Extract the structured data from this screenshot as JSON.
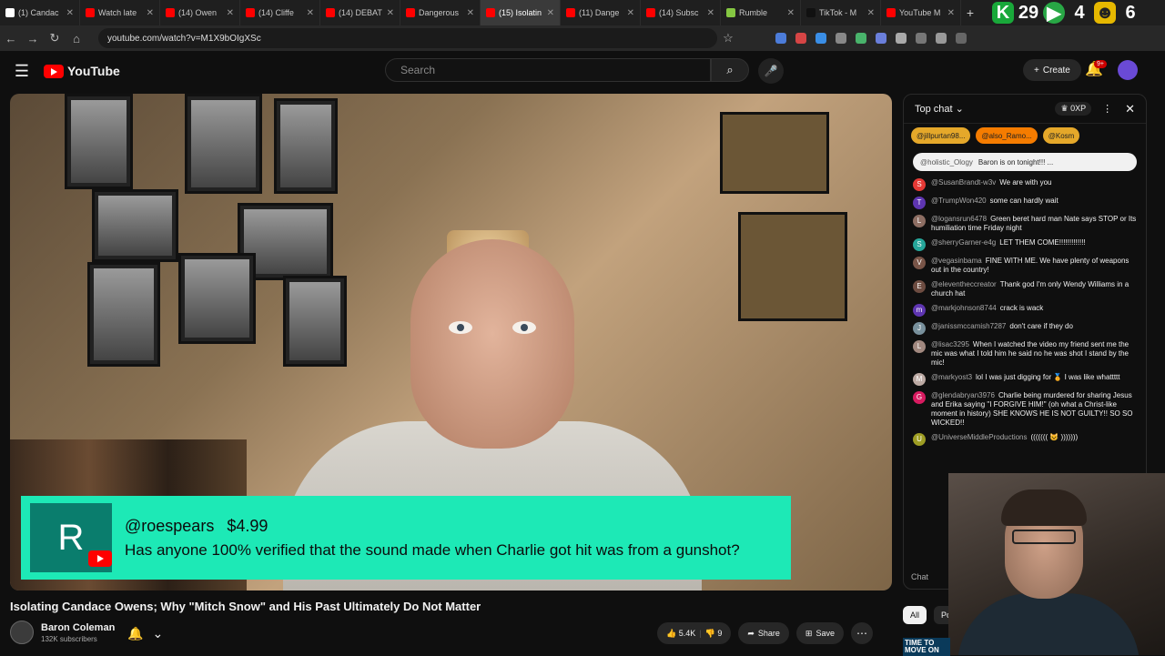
{
  "browser": {
    "tabs": [
      {
        "label": "(1) Candac",
        "color": "#ffffff",
        "active": false
      },
      {
        "label": "Watch late",
        "color": "#ff0000",
        "active": false
      },
      {
        "label": "(14) Owen",
        "color": "#ff0000",
        "active": false
      },
      {
        "label": "(14) Cliffe",
        "color": "#ff0000",
        "active": false
      },
      {
        "label": "(14) DEBAT",
        "color": "#ff0000",
        "active": false
      },
      {
        "label": "Dangerous",
        "color": "#ff0000",
        "active": false
      },
      {
        "label": "(15) Isolatin",
        "color": "#ff0000",
        "active": true
      },
      {
        "label": "(11) Dange",
        "color": "#ff0000",
        "active": false
      },
      {
        "label": "(14) Subsc",
        "color": "#ff0000",
        "active": false
      },
      {
        "label": "Rumble",
        "color": "#85c742",
        "active": false
      },
      {
        "label": "TikTok - M",
        "color": "#111111",
        "active": false
      },
      {
        "label": "YouTube M",
        "color": "#ff0000",
        "active": false
      }
    ],
    "url": "youtube.com/watch?v=M1X9bOIgXSc",
    "overlay_numbers": [
      "29",
      "4",
      "6"
    ]
  },
  "header": {
    "logo_text": "YouTube",
    "search_placeholder": "Search",
    "create_label": "Create",
    "notification_count": "9+"
  },
  "superchat": {
    "initial": "R",
    "user": "@roespears",
    "amount": "$4.99",
    "message": "Has anyone 100% verified that the sound made when Charlie got hit was from a gunshot?"
  },
  "video": {
    "title": "Isolating Candace Owens; Why \"Mitch Snow\" and His Past Ultimately Do Not Matter",
    "channel": "Baron Coleman",
    "subscribers": "132K subscribers",
    "likes": "5.4K",
    "dislikes": "9",
    "share_label": "Share",
    "save_label": "Save"
  },
  "chat": {
    "mode": "Top chat",
    "xp": "0XP",
    "tickers": [
      "@jillpurtan98...",
      "@also_Ramo...",
      "@Kosm"
    ],
    "pinned_user": "@holistic_Ology",
    "pinned_text": "Baron is on tonight!!! ...",
    "messages": [
      {
        "user": "@SusanBrandt-w3v",
        "text": "We are with you",
        "initial": "S",
        "color": "#e53935"
      },
      {
        "user": "@TrumpWon420",
        "text": "some can hardly wait",
        "initial": "T",
        "color": "#5e35b1"
      },
      {
        "user": "@logansrun6478",
        "text": "Green beret hard man Nate says STOP or Its humiliation time Friday night",
        "initial": "L",
        "color": "#8d6e63"
      },
      {
        "user": "@sherryGarner-e4g",
        "text": "LET THEM COME!!!!!!!!!!!!!",
        "initial": "S",
        "color": "#26a69a"
      },
      {
        "user": "@vegasinbama",
        "text": "FINE WITH ME. We have plenty of weapons out in the country!",
        "initial": "V",
        "color": "#795548"
      },
      {
        "user": "@eleventheccreator",
        "text": "Thank god I'm only Wendy Williams in a church hat",
        "initial": "E",
        "color": "#6d4c41"
      },
      {
        "user": "@markjohnson8744",
        "text": "crack is wack",
        "initial": "m",
        "color": "#5e35b1"
      },
      {
        "user": "@janissmccamish7287",
        "text": "don't care if they do",
        "initial": "J",
        "color": "#78909c"
      },
      {
        "user": "@lisac3295",
        "text": "When I watched the video my friend sent me the mic was what I told him he said no he was shot I stand by the mic!",
        "initial": "L",
        "color": "#a1887f"
      },
      {
        "user": "@markyost3",
        "text": "lol I was just digging for 🏅 I was like whattttt",
        "initial": "M",
        "color": "#bcaaa4"
      },
      {
        "user": "@glendabryan3976",
        "text": "Charlie being murdered for sharing Jesus and Erika saying \"I FORGIVE HIM!\" (oh what a Christ-like moment in history) SHE KNOWS HE IS NOT GUILTY!! SO SO WICKED!!",
        "initial": "G",
        "color": "#d81b60"
      },
      {
        "user": "@UniverseMiddleProductions",
        "text": "((((((( 😺 )))))))",
        "initial": "U",
        "color": "#9e9d24"
      }
    ],
    "footer": "Chat",
    "chips": [
      "All",
      "Po"
    ]
  },
  "webcam_ad_text": "TIME TO MOVE ON"
}
